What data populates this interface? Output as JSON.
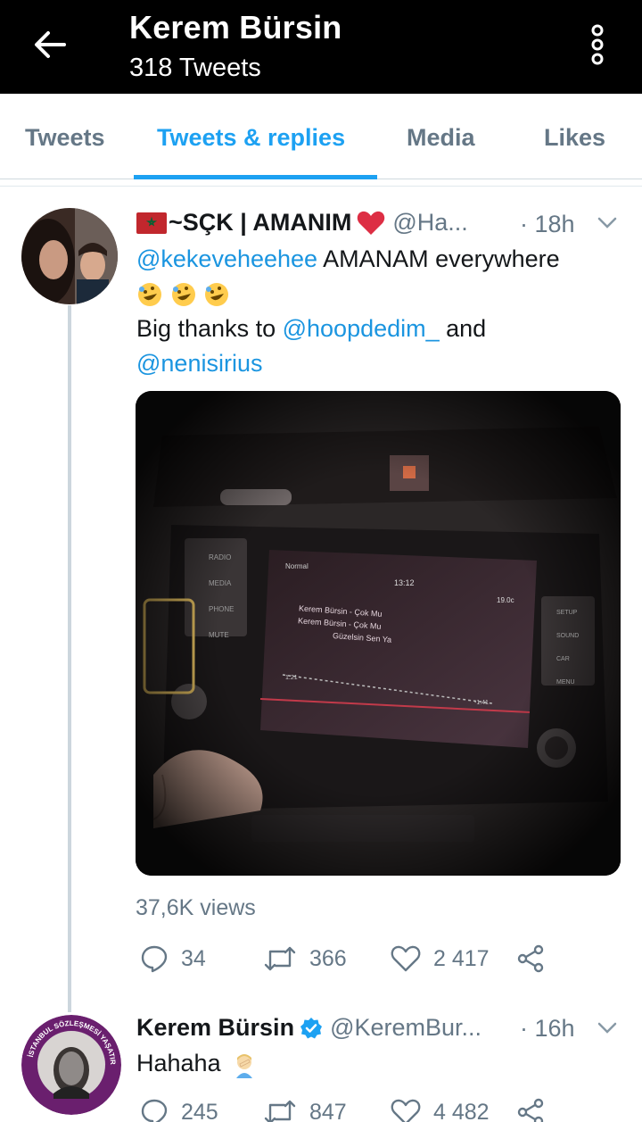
{
  "header": {
    "title": "Kerem Bürsin",
    "subtitle": "318 Tweets"
  },
  "tabs": [
    {
      "label": "Tweets"
    },
    {
      "label": "Tweets & replies",
      "active": true
    },
    {
      "label": "Media"
    },
    {
      "label": "Likes"
    }
  ],
  "tweet1": {
    "display_name": "~SÇK | AMANIM",
    "handle": "@Ha...",
    "time": "· 18h",
    "mention1": "@kekeveheehee",
    "text1": " AMANAM everywhere",
    "emojis": [
      "rolling-on-floor-laughing",
      "rolling-on-floor-laughing",
      "rolling-on-floor-laughing"
    ],
    "text2_prefix": "Big thanks to ",
    "mention2": "@hoopdedim_",
    "text2_suffix": " and",
    "mention3": "@nenisirius",
    "views": "37,6K views",
    "replies": "34",
    "retweets": "366",
    "likes": "2 417",
    "video_screen": {
      "left_buttons": [
        "RADIO",
        "MEDIA",
        "PHONE",
        "MUTE"
      ],
      "right_buttons": [
        "SETUP",
        "SOUND",
        "CAR",
        "MENU"
      ],
      "source": "Normal",
      "clock": "13:12",
      "temp": "19.0c",
      "track_line1": "Kerem Bürsin - Çok Mu",
      "track_line2": "Kerem Bürsin - Çok Mu",
      "track_line3": "Güzelsin Sen Ya",
      "elapsed": "1:21",
      "remaining": "-1:41"
    }
  },
  "tweet2": {
    "display_name": "Kerem Bürsin",
    "handle": "@KeremBur...",
    "time": "· 16h",
    "text": "Hahaha",
    "replies": "245",
    "retweets": "847",
    "likes": "4 482",
    "avatar_ring_text": "İSTANBUL SÖZLEŞMESİ YAŞATIR"
  },
  "colors": {
    "accent": "#1da1f2",
    "mention": "#1b95e0",
    "secondary_text": "#657786",
    "heart": "#e0245e",
    "verified": "#1da1f2"
  }
}
